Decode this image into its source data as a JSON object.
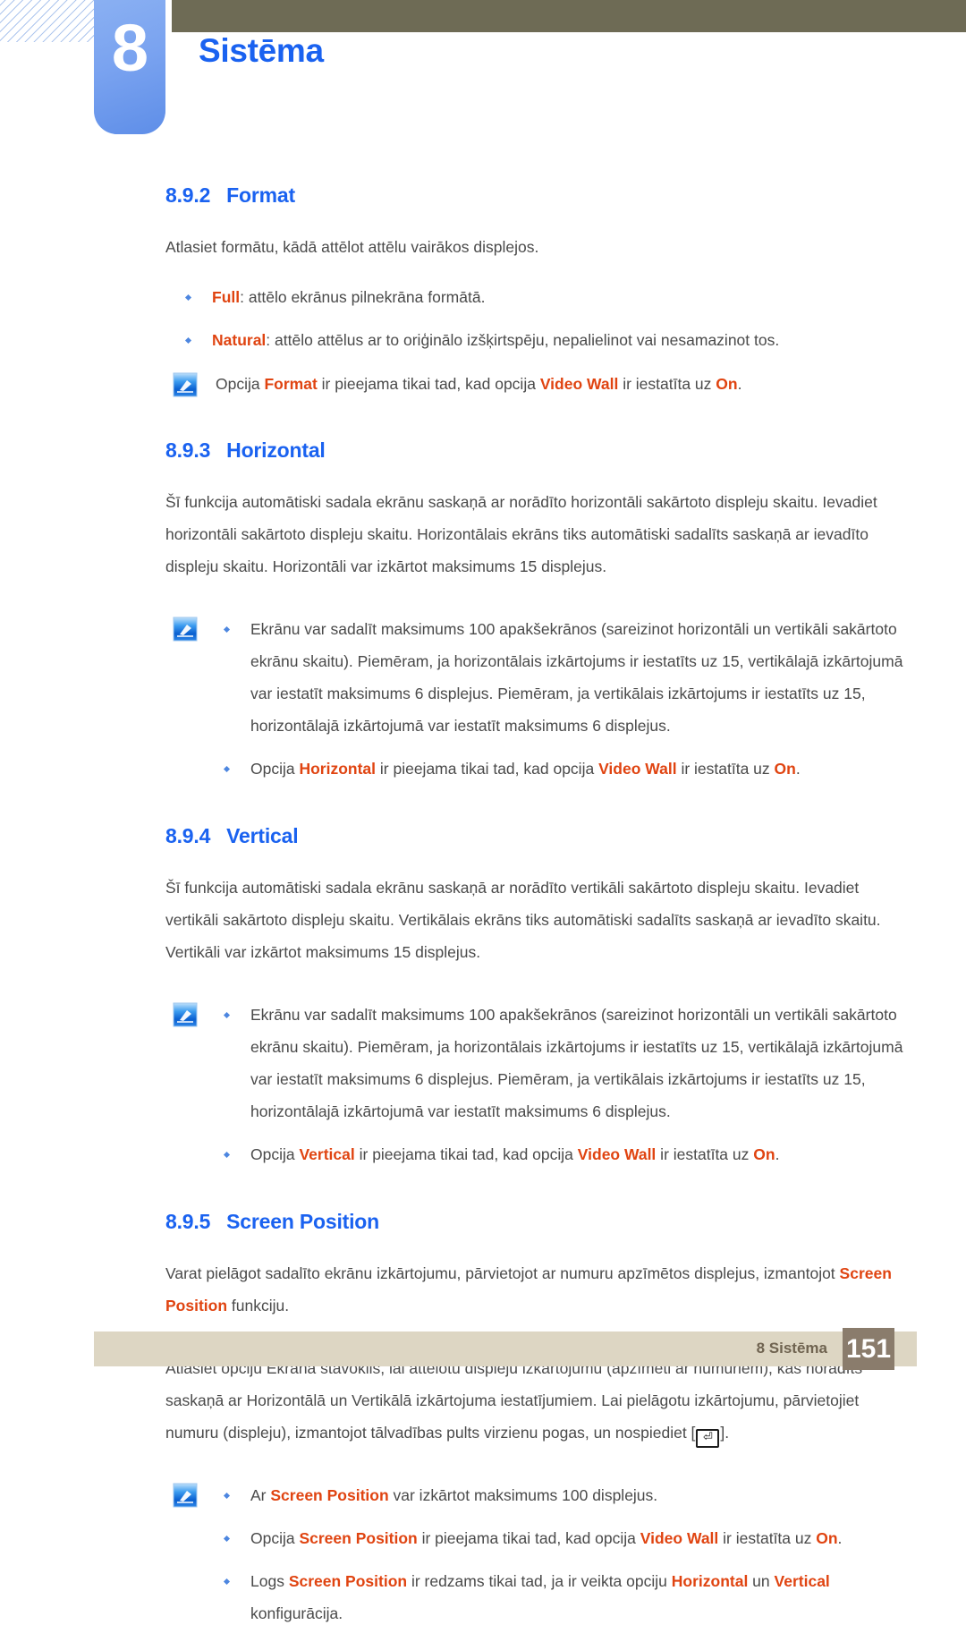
{
  "header": {
    "chapter_number": "8",
    "chapter_title": "Sistēma",
    "accent_blue": "#1a62f0",
    "olive_bar_color": "#6e6b55",
    "tab_color": "#7aa3f0"
  },
  "sections": [
    {
      "number": "8.9.2",
      "title": "Format",
      "intro": "Atlasiet formātu, kādā attēlot attēlu vairākos displejos.",
      "bullets": [
        {
          "kw": "Full",
          "rest": ": attēlo ekrānus pilnekrāna formātā."
        },
        {
          "kw": "Natural",
          "rest": ": attēlo attēlus ar to oriģinālo izšķirtspēju, nepalielinot vai nesamazinot tos."
        }
      ],
      "note_single": {
        "pre": "Opcija ",
        "kw1": "Format",
        "mid": " ir pieejama tikai tad, kad opcija ",
        "kw2": "Video Wall",
        "mid2": " ir iestatīta uz ",
        "kw3": "On",
        "post": "."
      }
    },
    {
      "number": "8.9.3",
      "title": "Horizontal",
      "intro": "Šī funkcija automātiski sadala ekrānu saskaņā ar norādīto horizontāli sakārtoto displeju skaitu. Ievadiet horizontāli sakārtoto displeju skaitu. Horizontālais ekrāns tiks automātiski sadalīts saskaņā ar ievadīto displeju skaitu. Horizontāli var izkārtot maksimums 15 displejus.",
      "note_bullets": {
        "first": "Ekrānu var sadalīt maksimums 100 apakšekrānos (sareizinot horizontāli un vertikāli sakārtoto ekrānu skaitu). Piemēram, ja horizontālais izkārtojums ir iestatīts uz 15, vertikālajā izkārtojumā var iestatīt maksimums 6 displejus. Piemēram, ja vertikālais izkārtojums ir iestatīts uz 15, horizontālajā izkārtojumā var iestatīt maksimums 6 displejus.",
        "second": {
          "pre": "Opcija ",
          "kw1": "Horizontal",
          "mid": " ir pieejama tikai tad, kad opcija ",
          "kw2": "Video Wall",
          "mid2": " ir iestatīta uz ",
          "kw3": "On",
          "post": "."
        }
      }
    },
    {
      "number": "8.9.4",
      "title": "Vertical",
      "intro": "Šī funkcija automātiski sadala ekrānu saskaņā ar norādīto vertikāli sakārtoto displeju skaitu. Ievadiet vertikāli sakārtoto displeju skaitu. Vertikālais ekrāns tiks automātiski sadalīts saskaņā ar ievadīto skaitu. Vertikāli var izkārtot maksimums 15 displejus.",
      "note_bullets": {
        "first": "Ekrānu var sadalīt maksimums 100 apakšekrānos (sareizinot horizontāli un vertikāli sakārtoto ekrānu skaitu). Piemēram, ja horizontālais izkārtojums ir iestatīts uz 15, vertikālajā izkārtojumā var iestatīt maksimums 6 displejus. Piemēram, ja vertikālais izkārtojums ir iestatīts uz 15, horizontālajā izkārtojumā var iestatīt maksimums 6 displejus.",
        "second": {
          "pre": "Opcija ",
          "kw1": "Vertical",
          "mid": " ir pieejama tikai tad, kad opcija ",
          "kw2": "Video Wall",
          "mid2": " ir iestatīta uz ",
          "kw3": "On",
          "post": "."
        }
      }
    },
    {
      "number": "8.9.5",
      "title": "Screen Position",
      "para1": {
        "pre": "Varat pielāgot sadalīto ekrānu izkārtojumu, pārvietojot ar numuru apzīmētos displejus, izmantojot ",
        "kw1": "Screen Position",
        "post": " funkciju."
      },
      "para2": {
        "pre": "Atlasiet opciju Ekrāna stāvoklis, lai attēlotu displeju izkārtojumu (apzīmēti ar numuriem), kas norādīts saskaņā ar Horizontālā un Vertikālā izkārtojuma iestatījumiem. Lai pielāgotu izkārtojumu, pārvietojiet numuru (displeju), izmantojot tālvadības pults virzienu pogas, un nospiediet [",
        "key": "⏎",
        "post": "]."
      },
      "note_bullets": {
        "b1": {
          "pre": "Ar ",
          "kw1": "Screen Position",
          "post": " var izkārtot maksimums 100 displejus."
        },
        "b2": {
          "pre": "Opcija ",
          "kw1": "Screen Position",
          "mid": " ir pieejama tikai tad, kad opcija ",
          "kw2": "Video Wall",
          "mid2": " ir iestatīta uz ",
          "kw3": "On",
          "post": "."
        },
        "b3": {
          "pre": "Logs ",
          "kw1": "Screen Position",
          "mid": " ir redzams tikai tad, ja ir veikta opciju ",
          "kw2": "Horizontal",
          "mid2": " un ",
          "kw3": "Vertical",
          "post": " konfigurācija."
        }
      }
    }
  ],
  "footer": {
    "label": "8 Sistēma",
    "page_number": "151",
    "bar_color": "#ddd6c3",
    "page_box_color": "#8a7c6c"
  },
  "colors": {
    "keyword_orange": "#e04411",
    "body_gray": "#4a4a4a",
    "bullet_blue": "#4d86e0"
  }
}
